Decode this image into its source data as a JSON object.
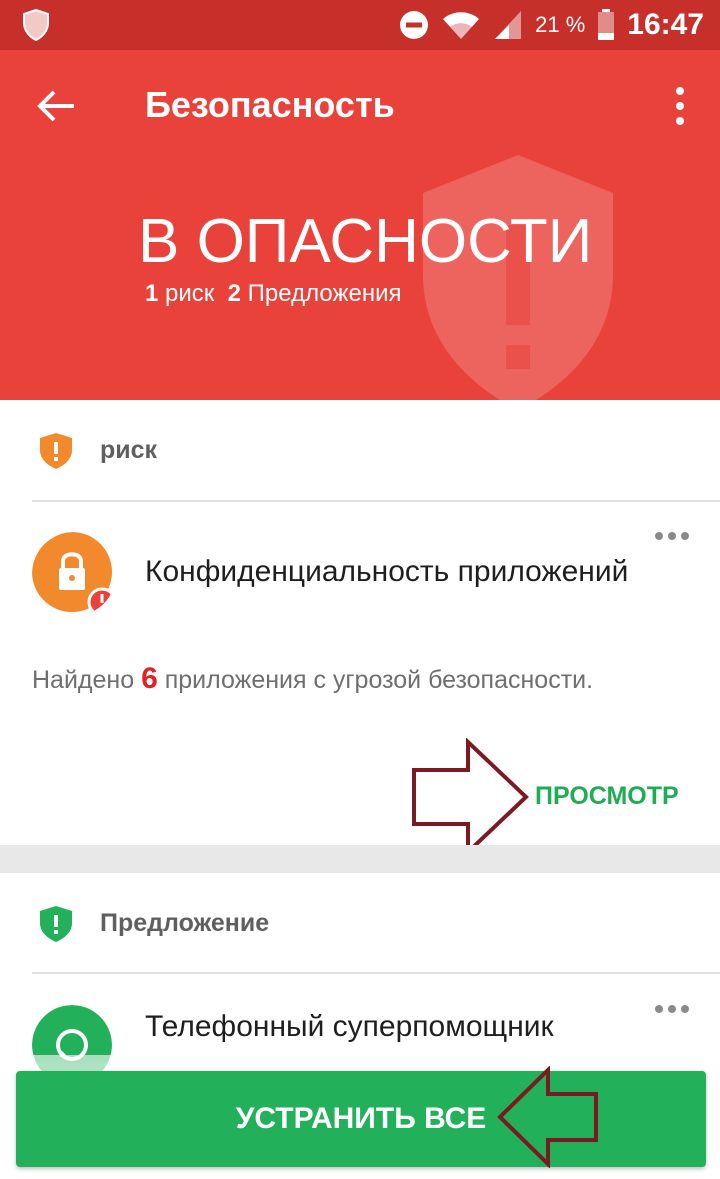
{
  "status_bar": {
    "battery": "21 %",
    "time": "16:47"
  },
  "header": {
    "title": "Безопасность",
    "status": "В ОПАСНОСТИ",
    "risk_count": "1",
    "risk_label": "риск",
    "suggestion_count": "2",
    "suggestion_label": "Предложения"
  },
  "risk_section": {
    "label": "риск",
    "card": {
      "title": "Конфиденциальность приложений",
      "desc_prefix": "Найдено ",
      "desc_count": "6",
      "desc_suffix": " приложения с угрозой безопасности.",
      "action": "ПРОСМОТР"
    }
  },
  "suggestion_section": {
    "label": "Предложение",
    "card": {
      "title": "Телефонный суперпомощник"
    }
  },
  "fix_all": "УСТРАНИТЬ ВСЕ",
  "colors": {
    "header": "#e8423a",
    "status_bar": "#c62f2a",
    "accent_green": "#22b05a",
    "risk_orange": "#f2892c"
  }
}
